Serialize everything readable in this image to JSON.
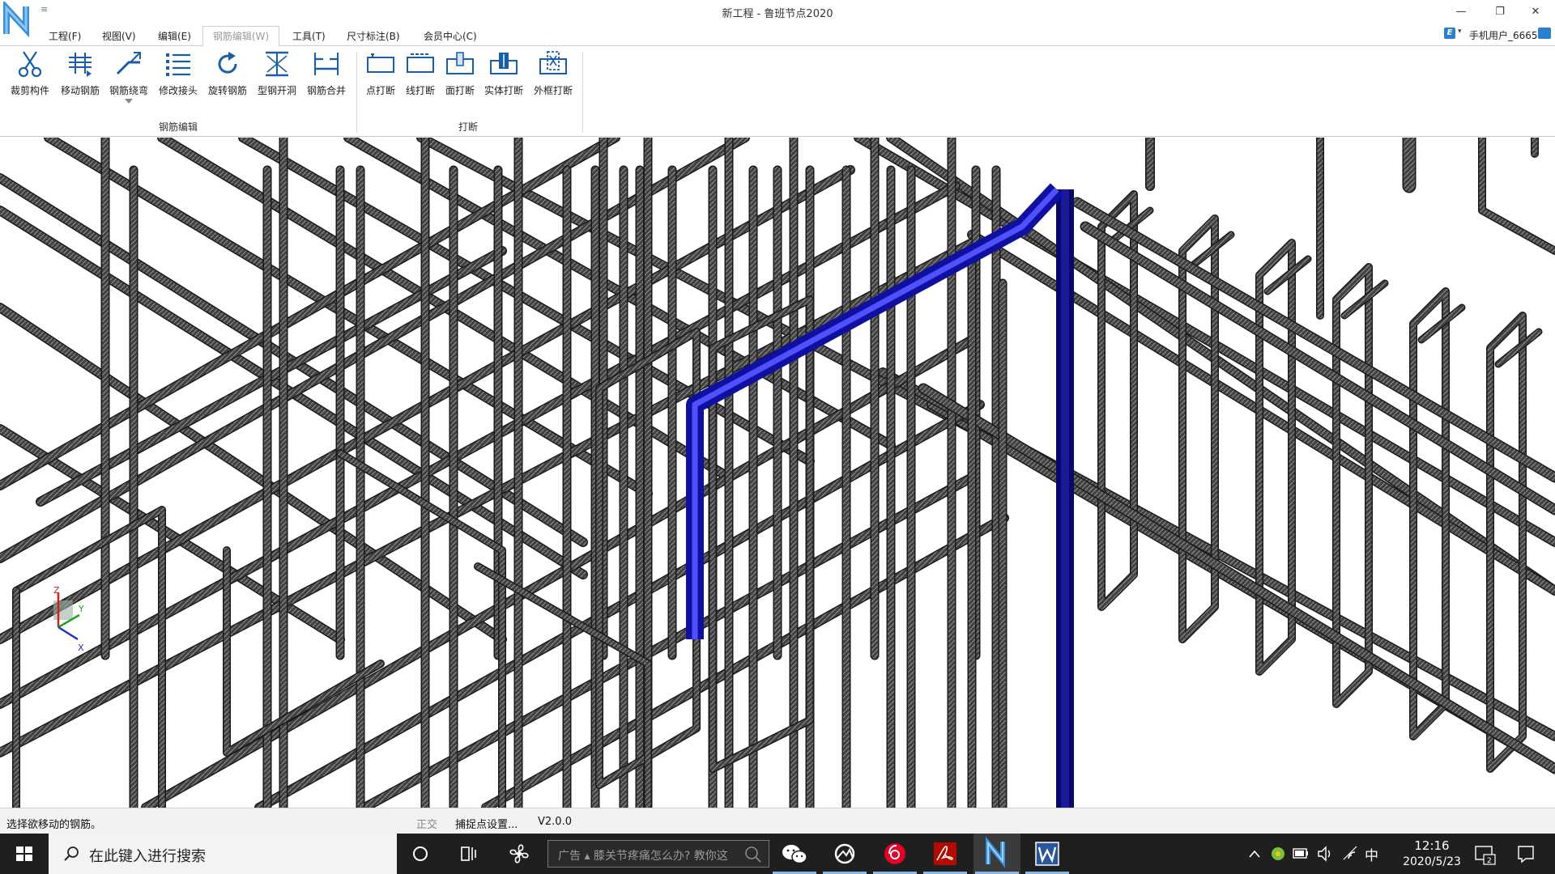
{
  "window": {
    "title": "新工程 - 鲁班节点2020",
    "qa_symbol": "≡",
    "min": "—",
    "max": "❐",
    "close": "✕"
  },
  "menu": {
    "items": [
      "工程(F)",
      "视图(V)",
      "编辑(E)",
      "钢筋编辑(W)",
      "工具(T)",
      "尺寸标注(B)",
      "会员中心(C)"
    ],
    "active_index": 3
  },
  "user": {
    "name": "手机用户_6665",
    "e_glyph": "E",
    "caret": "▾"
  },
  "ribbon": {
    "groups": [
      {
        "label": "钢筋编辑",
        "tools": [
          {
            "label": "裁剪构件",
            "icon": "scissors-icon"
          },
          {
            "label": "移动钢筋",
            "icon": "move-rebar-icon"
          },
          {
            "label": "钢筋绕弯",
            "icon": "bend-rebar-icon"
          },
          {
            "label": "修改接头",
            "icon": "list-joint-icon"
          },
          {
            "label": "旋转钢筋",
            "icon": "rotate-icon"
          },
          {
            "label": "型钢开洞",
            "icon": "steel-hole-icon"
          },
          {
            "label": "钢筋合并",
            "icon": "merge-rebar-icon"
          }
        ]
      },
      {
        "label": "打断",
        "tools": [
          {
            "label": "点打断",
            "icon": "point-break-icon"
          },
          {
            "label": "线打断",
            "icon": "line-break-icon"
          },
          {
            "label": "面打断",
            "icon": "face-break-icon"
          },
          {
            "label": "实体打断",
            "icon": "solid-break-icon"
          },
          {
            "label": "外框打断",
            "icon": "frame-break-icon"
          }
        ]
      }
    ]
  },
  "axes": {
    "z": "Z",
    "y": "Y",
    "x": "X"
  },
  "status": {
    "prompt": "选择欲移动的钢筋。",
    "ortho": "正交",
    "snap": "捕捉点设置...",
    "version": "V2.0.0"
  },
  "taskbar": {
    "search_placeholder": "在此键入进行搜索",
    "ad_text": "广告 ▴  膝关节疼痛怎么办? 教你这",
    "ime": "中",
    "time": "12:16",
    "date": "2020/5/23",
    "notification_count": "2"
  },
  "colors": {
    "highlight_rebar": "#1a1acc",
    "highlight_rebar_dark": "#0a0a66",
    "rebar": "#3a3a3a",
    "taskbar": "#1f1f1f"
  }
}
